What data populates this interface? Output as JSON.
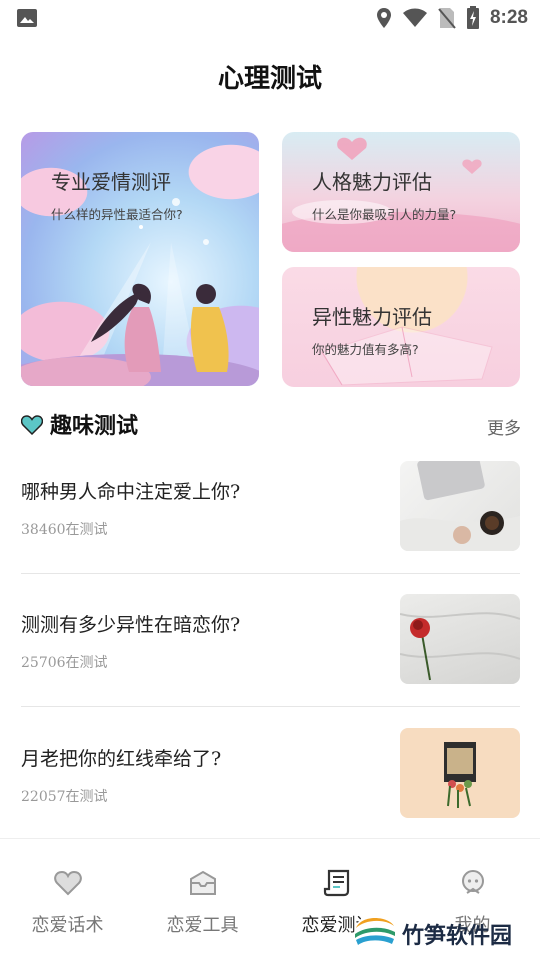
{
  "status_bar": {
    "time": "8:28",
    "icons": [
      "image-icon",
      "location-icon",
      "wifi-icon",
      "no-sim-icon",
      "battery-charging-icon"
    ]
  },
  "page": {
    "title": "心理测试"
  },
  "featured": {
    "love": {
      "title": "专业爱情测评",
      "subtitle": "什么样的异性最适合你?"
    },
    "personality": {
      "title": "人格魅力评估",
      "subtitle": "什么是你最吸引人的力量?"
    },
    "attraction": {
      "title": "异性魅力评估",
      "subtitle": "你的魅力值有多高?"
    }
  },
  "fun_tests": {
    "title": "趣味测试",
    "more_label": "更多",
    "items": [
      {
        "title": "哪种男人命中注定爱上你?",
        "count": "38460在测试",
        "thumb": "laptop-coffee-photo"
      },
      {
        "title": "测测有多少异性在暗恋你?",
        "count": "25706在测试",
        "thumb": "rose-on-sheets-photo"
      },
      {
        "title": "月老把你的红线牵给了?",
        "count": "22057在测试",
        "thumb": "flower-box-photo"
      }
    ]
  },
  "tabbar": {
    "tabs": [
      {
        "label": "恋爱话术",
        "icon": "heart-icon"
      },
      {
        "label": "恋爱工具",
        "icon": "box-icon"
      },
      {
        "label": "恋爱测试",
        "icon": "document-icon",
        "active": true
      },
      {
        "label": "我的",
        "icon": "profile-icon"
      }
    ]
  },
  "watermark": {
    "text": "竹笋软件园"
  },
  "colors": {
    "accent": "#5cc6c6",
    "text_primary": "#222222",
    "text_secondary": "#999999"
  }
}
